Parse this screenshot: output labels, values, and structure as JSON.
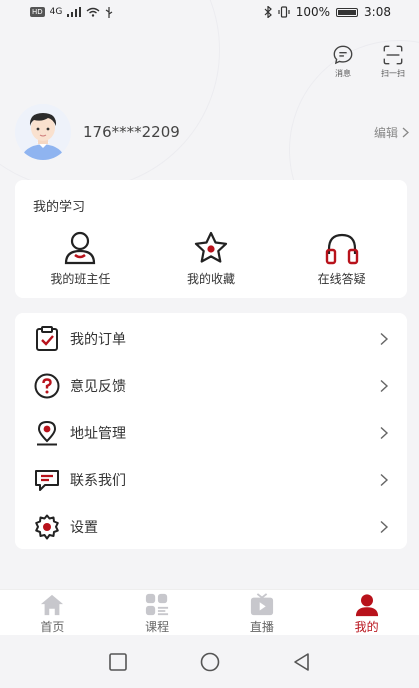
{
  "status_bar": {
    "hd": "HD",
    "net": "4G",
    "battery": "100%",
    "time": "3:08"
  },
  "top_actions": [
    {
      "label": "消息",
      "icon": "message-icon"
    },
    {
      "label": "扫一扫",
      "icon": "scan-icon"
    }
  ],
  "profile": {
    "phone": "176****2209",
    "edit_label": "编辑"
  },
  "study": {
    "title": "我的学习",
    "items": [
      {
        "label": "我的班主任",
        "icon": "head-teacher-icon"
      },
      {
        "label": "我的收藏",
        "icon": "favorites-star-icon"
      },
      {
        "label": "在线答疑",
        "icon": "headphones-icon"
      }
    ]
  },
  "menu": [
    {
      "label": "我的订单",
      "icon": "order-clipboard-icon"
    },
    {
      "label": "意见反馈",
      "icon": "question-icon"
    },
    {
      "label": "地址管理",
      "icon": "location-pin-icon"
    },
    {
      "label": "联系我们",
      "icon": "chat-bubble-icon"
    },
    {
      "label": "设置",
      "icon": "gear-icon"
    }
  ],
  "tabs": [
    {
      "label": "首页",
      "icon": "home-icon",
      "active": false
    },
    {
      "label": "课程",
      "icon": "course-grid-icon",
      "active": false
    },
    {
      "label": "直播",
      "icon": "live-tv-icon",
      "active": false
    },
    {
      "label": "我的",
      "icon": "profile-icon",
      "active": true
    }
  ],
  "colors": {
    "accent": "#b8121b",
    "inactive_icon": "#c7c7cc"
  }
}
